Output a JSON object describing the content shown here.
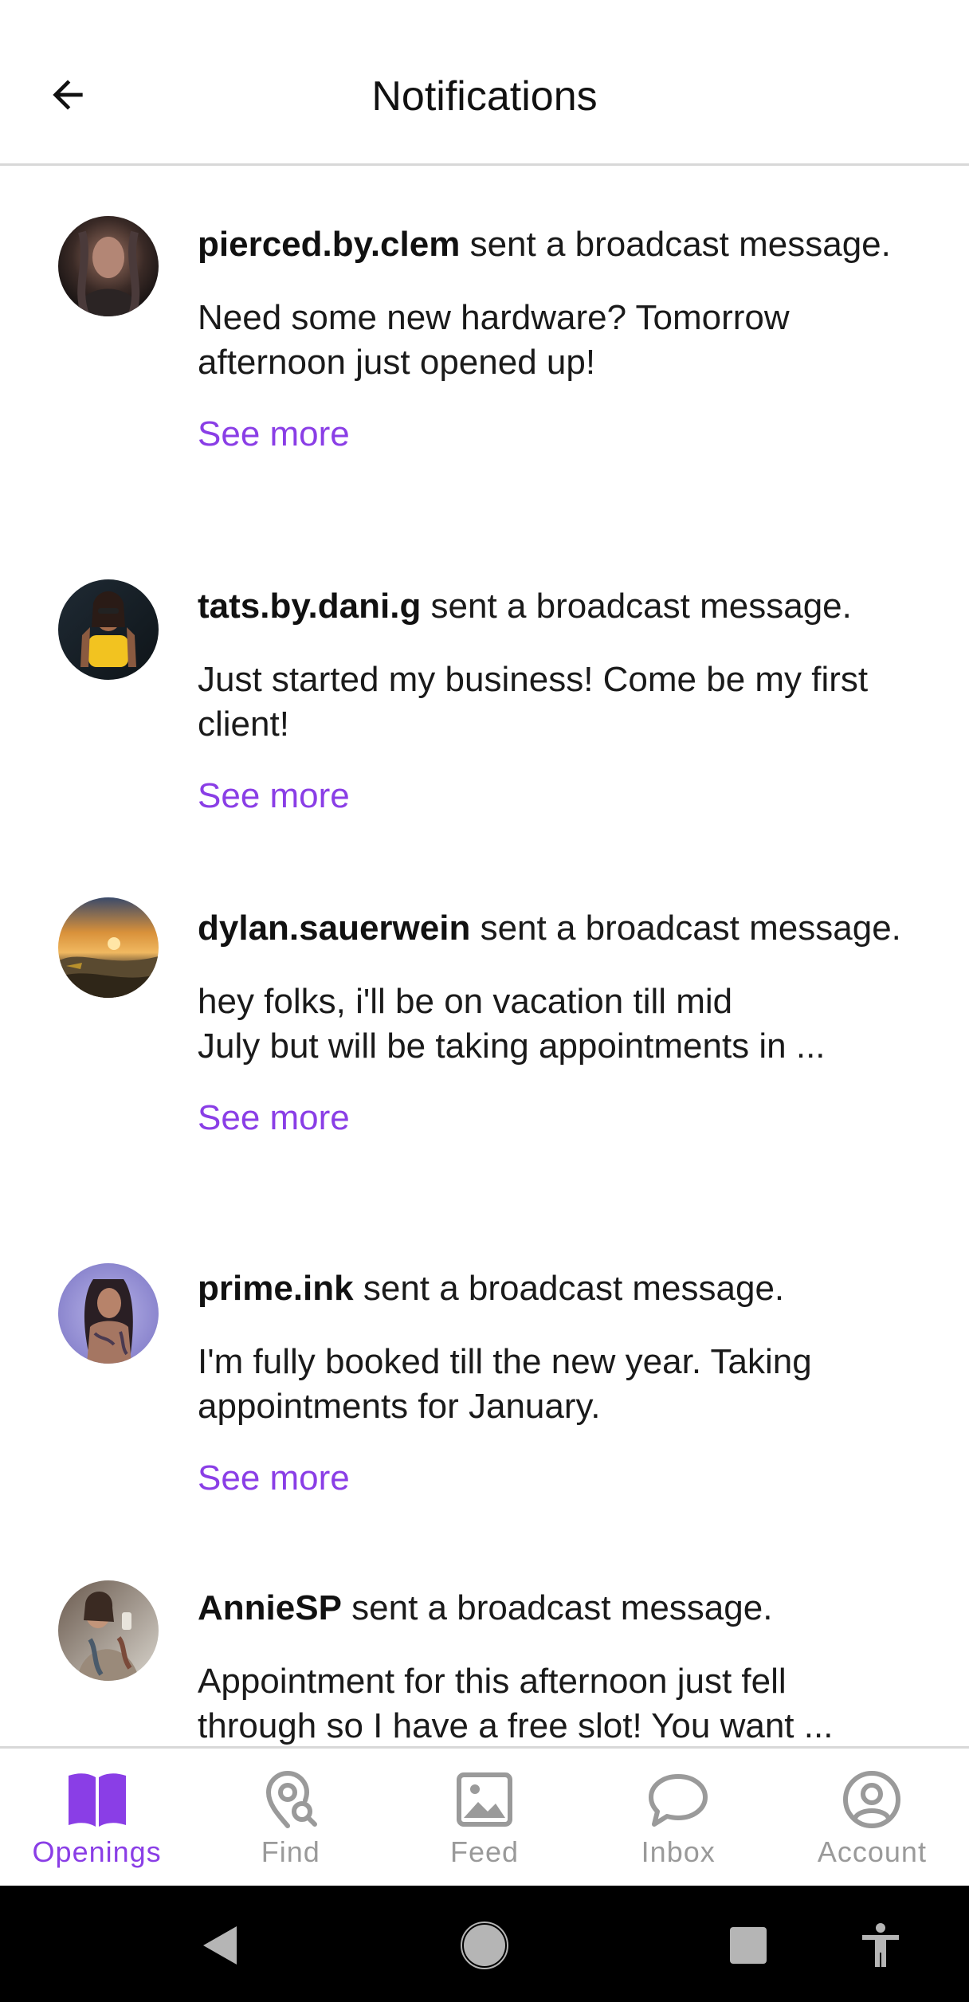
{
  "header": {
    "title": "Notifications",
    "back_icon": "arrow-left-icon"
  },
  "notifications": [
    {
      "username": "pierced.by.clem",
      "action": " sent a broadcast message.",
      "message": "Need some new hardware? Tomorrow afternoon just opened up!",
      "see_more": "See more"
    },
    {
      "username": "tats.by.dani.g",
      "action": " sent a broadcast message.",
      "message": "Just started my business! Come be my first client!",
      "see_more": "See more"
    },
    {
      "username": "dylan.sauerwein",
      "action": " sent a broadcast message.",
      "message_line1": "hey folks, i'll be on vacation till mid",
      "message_line2": "July but will be taking appointments in ...",
      "see_more": "See more"
    },
    {
      "username": "prime.ink",
      "action": " sent a broadcast message.",
      "message": "I'm fully booked till the new year. Taking appointments for January.",
      "see_more": "See more"
    },
    {
      "username": "AnnieSP",
      "action": " sent a broadcast message.",
      "message_line1": "Appointment for this afternoon just fell",
      "message_line2": "through so I have a free slot! You want ..."
    }
  ],
  "bottom_nav": {
    "items": [
      {
        "label": "Openings",
        "icon": "book-open-icon",
        "active": true
      },
      {
        "label": "Find",
        "icon": "map-pin-search-icon",
        "active": false
      },
      {
        "label": "Feed",
        "icon": "image-icon",
        "active": false
      },
      {
        "label": "Inbox",
        "icon": "chat-bubble-icon",
        "active": false
      },
      {
        "label": "Account",
        "icon": "user-circle-icon",
        "active": false
      }
    ]
  },
  "system_bar": {
    "icons": [
      "back-triangle-icon",
      "home-circle-icon",
      "recents-square-icon",
      "accessibility-icon"
    ]
  },
  "colors": {
    "accent": "#8a3ee6",
    "inactive": "#9a9a9a",
    "divider": "#d8d8d8"
  }
}
